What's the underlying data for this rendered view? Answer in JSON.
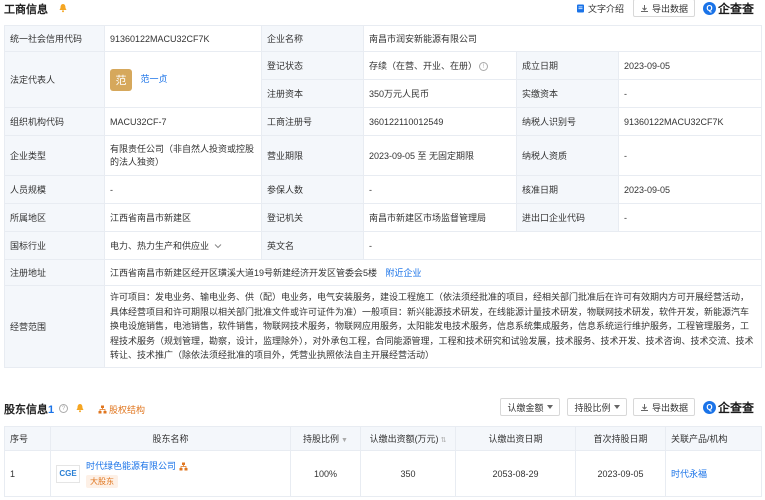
{
  "business": {
    "title": "工商信息",
    "text_intro": "文字介绍",
    "export": "导出数据",
    "logo": "企查查",
    "rows": {
      "credit_code_label": "统一社会信用代码",
      "credit_code": "91360122MACU32CF7K",
      "company_name_label": "企业名称",
      "company_name": "南昌市润安新能源有限公司",
      "legal_rep_label": "法定代表人",
      "legal_rep_avatar": "范",
      "legal_rep": "范一贞",
      "reg_status_label": "登记状态",
      "reg_status": "存续（在营、开业、在册）",
      "est_date_label": "成立日期",
      "est_date": "2023-09-05",
      "reg_capital_label": "注册资本",
      "reg_capital": "350万元人民币",
      "paid_capital_label": "实缴资本",
      "paid_capital": "-",
      "org_code_label": "组织机构代码",
      "org_code": "MACU32CF-7",
      "biz_reg_no_label": "工商注册号",
      "biz_reg_no": "360122110012549",
      "taxpayer_id_label": "纳税人识别号",
      "taxpayer_id": "91360122MACU32CF7K",
      "ent_type_label": "企业类型",
      "ent_type": "有限责任公司（非自然人投资或控股的法人独资）",
      "biz_term_label": "营业期限",
      "biz_term": "2023-09-05 至 无固定期限",
      "taxpayer_qual_label": "纳税人资质",
      "taxpayer_qual": "-",
      "staff_size_label": "人员规模",
      "staff_size": "-",
      "insured_label": "参保人数",
      "insured": "-",
      "approval_date_label": "核准日期",
      "approval_date": "2023-09-05",
      "region_label": "所属地区",
      "region": "江西省南昌市新建区",
      "reg_authority_label": "登记机关",
      "reg_authority": "南昌市新建区市场监督管理局",
      "ie_code_label": "进出口企业代码",
      "ie_code": "-",
      "industry_label": "国标行业",
      "industry": "电力、热力生产和供应业",
      "en_name_label": "英文名",
      "en_name": "-",
      "address_label": "注册地址",
      "address": "江西省南昌市新建区经开区璜溪大道19号新建经济开发区管委会5楼",
      "address_link": "附近企业",
      "scope_label": "经营范围",
      "scope": "许可项目：发电业务、输电业务、供（配）电业务，电气安装服务，建设工程施工（依法须经批准的项目，经相关部门批准后在许可有效期内方可开展经营活动，具体经营项目和许可期限以相关部门批准文件或许可证件为准）一般项目：新兴能源技术研发，在线能源计量技术研发，物联网技术研发，软件开发，新能源汽车换电设施销售，电池销售，软件销售，物联网技术服务，物联网应用服务，太阳能发电技术服务，信息系统集成服务，信息系统运行维护服务，工程管理服务，工程技术服务（规划管理，勘察，设计，监理除外），对外承包工程，合同能源管理，工程和技术研究和试验发展，技术服务、技术开发、技术咨询、技术交流、技术转让、技术推广（除依法须经批准的项目外，凭营业执照依法自主开展经营活动）"
    }
  },
  "shareholders": {
    "title": "股东信息",
    "count": "1",
    "equity_link": "股权结构",
    "filter_amount": "认缴金额",
    "filter_ratio": "持股比例",
    "export": "导出数据",
    "logo": "企查查",
    "headers": {
      "no": "序号",
      "name": "股东名称",
      "ratio": "持股比例",
      "amount": "认缴出资额(万元)",
      "date": "认缴出资日期",
      "first_date": "首次持股日期",
      "related": "关联产品/机构"
    },
    "rows": [
      {
        "no": "1",
        "logo_text": "CGE",
        "name": "时代绿色能源有限公司",
        "tag": "大股东",
        "ratio": "100%",
        "amount": "350",
        "date": "2053-08-29",
        "first_date": "2023-09-05",
        "related": "时代永福"
      }
    ]
  },
  "colors": {
    "accent": "#1a73e8",
    "label_bg": "#f4f7fb",
    "orange": "#e0761f"
  }
}
